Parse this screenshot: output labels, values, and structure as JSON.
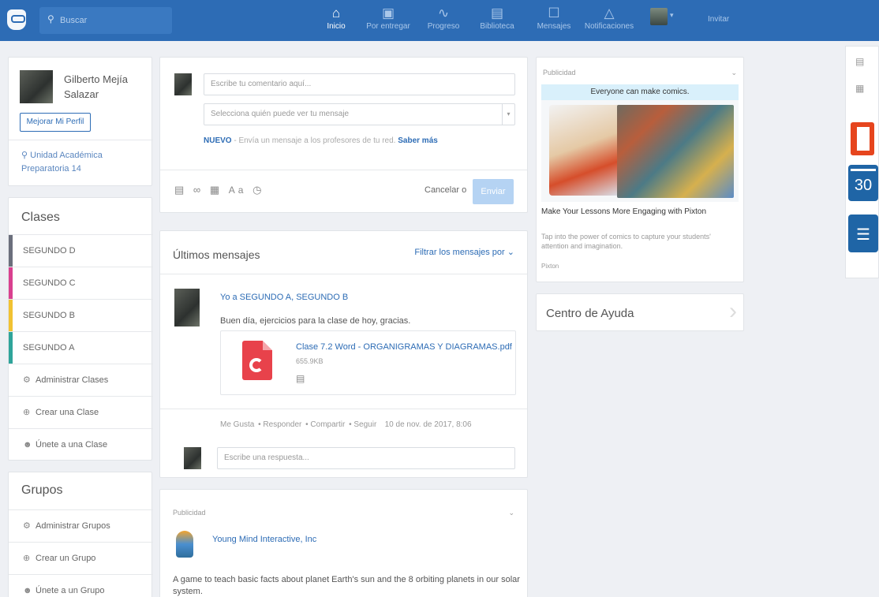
{
  "topbar": {
    "search_placeholder": "Buscar",
    "nav": [
      {
        "label": "Inicio",
        "icon": "home-icon"
      },
      {
        "label": "Por entregar",
        "icon": "assignment-icon"
      },
      {
        "label": "Progreso",
        "icon": "progress-icon"
      },
      {
        "label": "Biblioteca",
        "icon": "library-icon"
      },
      {
        "label": "Mensajes",
        "icon": "messages-icon"
      },
      {
        "label": "Notificaciones",
        "icon": "bell-icon"
      }
    ],
    "invite_label": "Invitar"
  },
  "profile": {
    "name_first": "Gilberto Mejía",
    "name_last": "Salazar",
    "improve_button": "Mejorar Mi Perfil",
    "location_line1": "Unidad Académica",
    "location_line2": "Preparatoria 14"
  },
  "classes": {
    "title": "Clases",
    "items": [
      {
        "label": "SEGUNDO D",
        "color": "#6b6f7c"
      },
      {
        "label": "SEGUNDO C",
        "color": "#d9408f"
      },
      {
        "label": "SEGUNDO B",
        "color": "#f1c232"
      },
      {
        "label": "SEGUNDO A",
        "color": "#2fa49a"
      }
    ],
    "manage": "Administrar Clases",
    "create": "Crear una Clase",
    "join": "Únete a una Clase"
  },
  "groups": {
    "title": "Grupos",
    "manage": "Administrar Grupos",
    "create": "Crear un Grupo",
    "join": "Únete a un Grupo"
  },
  "composer": {
    "comment_placeholder": "Escribe tu comentario aquí...",
    "audience_placeholder": "Selecciona quién puede ver tu mensaje",
    "nuevo_label": "NUEVO",
    "nuevo_text": " - Envía un mensaje a los profesores de tu red.",
    "learn_more": "Saber más",
    "cancel": "Cancelar",
    "or": "o",
    "send": "Enviar"
  },
  "messages": {
    "title": "Últimos mensajes",
    "filter": "Filtrar los mensajes por",
    "post": {
      "to": "Yo a SEGUNDO A, SEGUNDO B",
      "body": "Buen día, ejercicios para la clase de hoy, gracias.",
      "file_name": "Clase 7.2 Word - ORGANIGRAMAS Y DIAGRAMAS.pdf",
      "file_size": "655.9KB",
      "actions": [
        "Me Gusta",
        "Responder",
        "Compartir",
        "Seguir"
      ],
      "timestamp": "10 de nov. de 2017, 8:06"
    },
    "reply_placeholder": "Escribe una respuesta..."
  },
  "ad_bottom": {
    "label": "Publicidad",
    "advertiser": "Young Mind Interactive, Inc",
    "text": "A game to teach basic facts about planet Earth's sun and the 8 orbiting planets in our solar",
    "text2": "system."
  },
  "ad_right": {
    "label": "Publicidad",
    "banner": "Everyone can make comics.",
    "title": "Make Your Lessons More Engaging with Pixton",
    "desc": "Tap into the power of comics to capture your students' attention and imagination.",
    "source": "Pixton"
  },
  "help": {
    "title": "Centro de Ayuda"
  },
  "right_sidebar": {
    "calendar_day": "30"
  }
}
